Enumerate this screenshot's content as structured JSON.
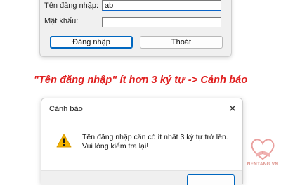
{
  "login": {
    "username_label": "Tên đăng nhập:",
    "username_value": "ab",
    "password_label": "Mật khẩu:",
    "password_value": "",
    "login_button": "Đăng nhập",
    "exit_button": "Thoát"
  },
  "caption": "\"Tên đăng nhập\" ít hơn 3 ký tự -> Cảnh báo",
  "dialog": {
    "title": "Cảnh báo",
    "close_icon": "close-icon",
    "icon": "warning-icon",
    "message_line1": "Tên đăng nhập cần có ít nhất 3 ký tự trở lên.",
    "message_line2": "Vui lòng kiểm tra lại!"
  },
  "watermark": {
    "text": "NENTANG.VN"
  },
  "colors": {
    "accent": "#0067c0",
    "caption": "#e02020",
    "warning": "#f5b400"
  }
}
